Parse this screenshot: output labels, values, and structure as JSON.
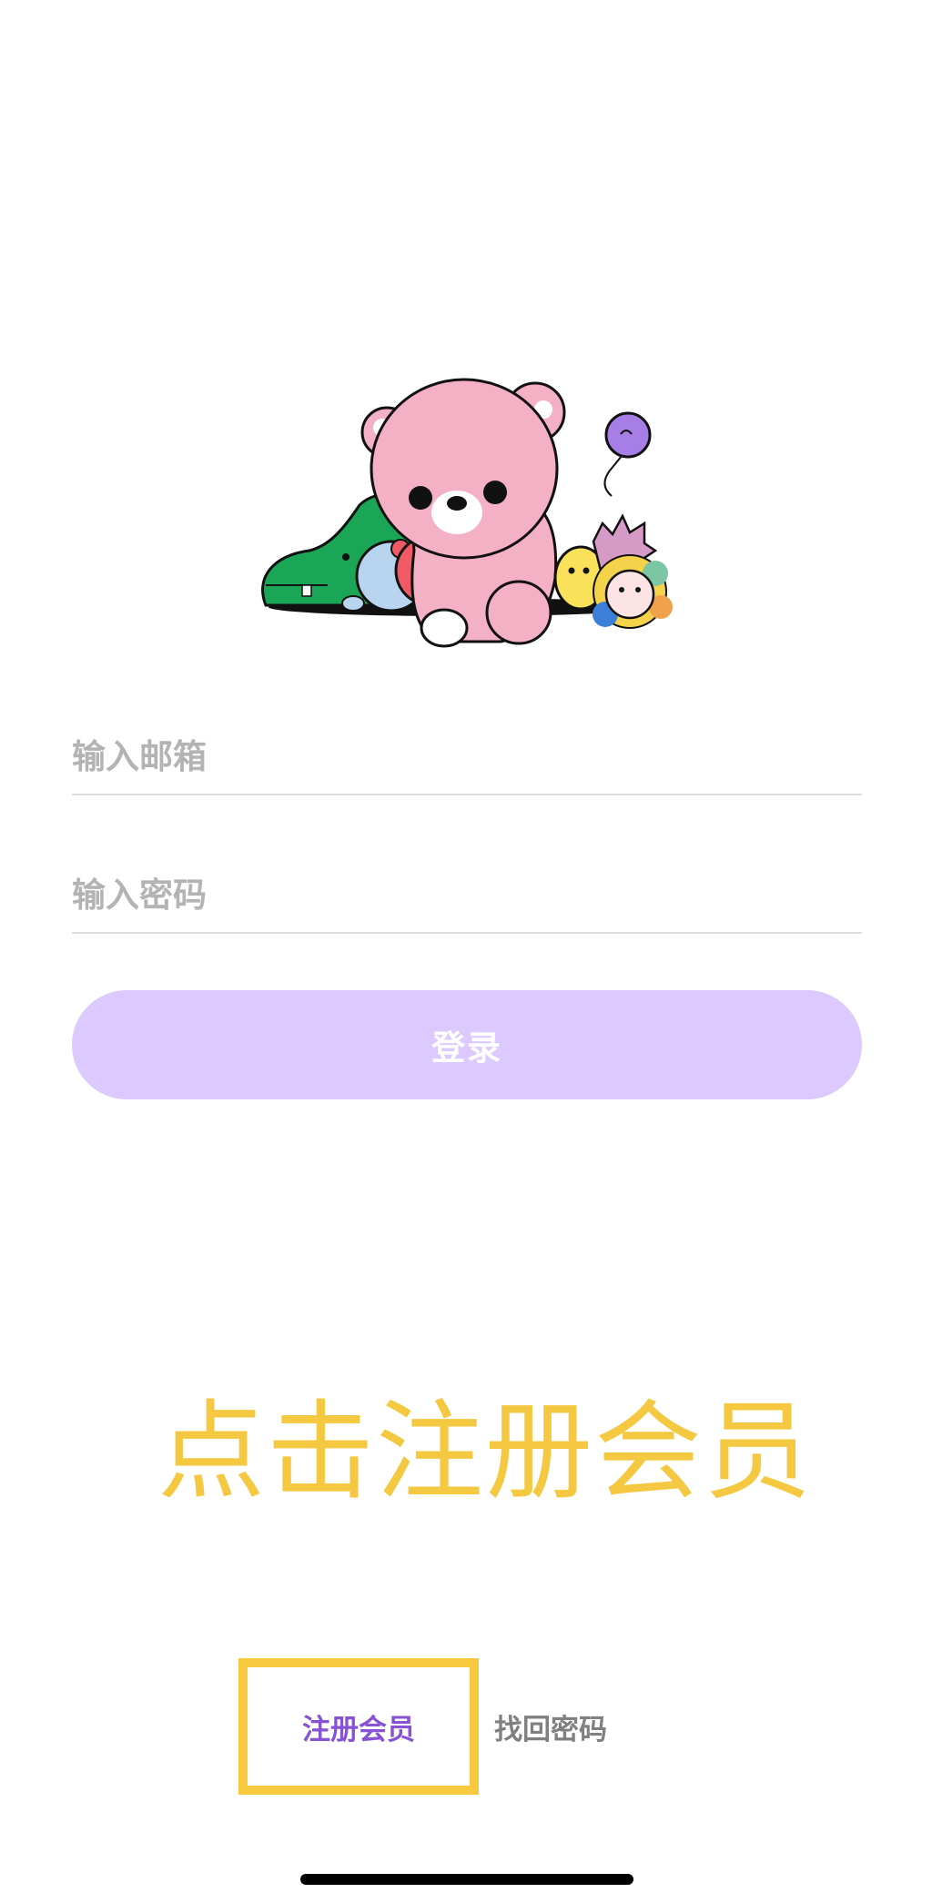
{
  "login_form": {
    "email_placeholder": "输入邮箱",
    "password_placeholder": "输入密码",
    "login_label": "登录"
  },
  "hint_text": "点击注册会员",
  "footer_links": {
    "register_label": "注册会员",
    "forgot_password_label": "找回密码"
  },
  "illustration": {
    "icon": "cute-mascot-group-illustration"
  },
  "colors": {
    "login_button": "#dccafe",
    "hint": "#f5c842",
    "highlight_box": "#f7c93f",
    "register_link": "#8752d4",
    "forgot_link": "#808080",
    "placeholder": "#b3b3b3"
  }
}
